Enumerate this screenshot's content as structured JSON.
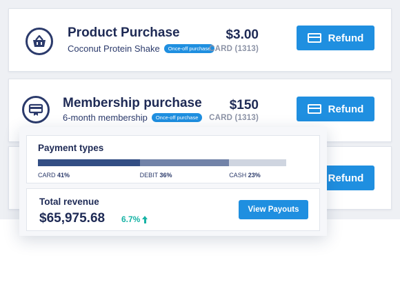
{
  "colors": {
    "accent": "#1f8fe0",
    "navy": "#1e2a55",
    "muted": "#8c93a6",
    "positive": "#16b3a5"
  },
  "transactions": [
    {
      "icon": "basket-icon",
      "title": "Product Purchase",
      "subtitle": "Coconut Protein Shake",
      "badge": "Once-off purchase",
      "amount": "$3.00",
      "method": "CARD (1313)",
      "action": "Refund"
    },
    {
      "icon": "membership-card-icon",
      "title": "Membership purchase",
      "subtitle": "6-month membership",
      "badge": "Once-off purchase",
      "amount": "$150",
      "method": "CARD (1313)",
      "action": "Refund"
    },
    {
      "action": "Refund"
    }
  ],
  "payment_types": {
    "title": "Payment types",
    "segments": [
      {
        "label": "CARD",
        "value_text": "41%",
        "value": 41,
        "color": "#334e84"
      },
      {
        "label": "DEBIT",
        "value_text": "36%",
        "value": 36,
        "color": "#7283a8"
      },
      {
        "label": "CASH",
        "value_text": "23%",
        "value": 23,
        "color": "#cfd5e0"
      }
    ]
  },
  "revenue": {
    "title": "Total revenue",
    "amount": "$65,975.68",
    "change": "6.7%",
    "change_direction": "up",
    "action": "View Payouts"
  }
}
